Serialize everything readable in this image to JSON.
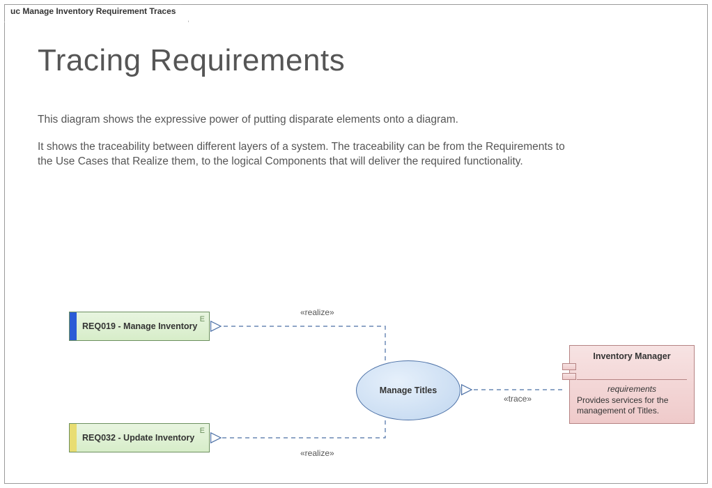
{
  "frame_tab": "uc Manage Inventory Requirement Traces",
  "title": "Tracing Requirements",
  "description_p1": "This diagram shows the expressive power of putting disparate elements onto a diagram.",
  "description_p2": "It shows the traceability between different layers of a system.  The traceability can be from the Requirements to the Use Cases that Realize them, to the logical Components that will deliver the required functionality.",
  "req1": {
    "label": "REQ019 - Manage Inventory",
    "corner": "E",
    "stripe_color": "#2b5bd6"
  },
  "req2": {
    "label": "REQ032 - Update Inventory",
    "corner": "E",
    "stripe_color": "#e8dd72"
  },
  "usecase": {
    "label": "Manage Titles"
  },
  "component": {
    "name": "Inventory Manager",
    "section_label": "requirements",
    "body": "Provides services for the management of Titles."
  },
  "conn1_label": "«realize»",
  "conn2_label": "«realize»",
  "conn3_label": "«trace»"
}
